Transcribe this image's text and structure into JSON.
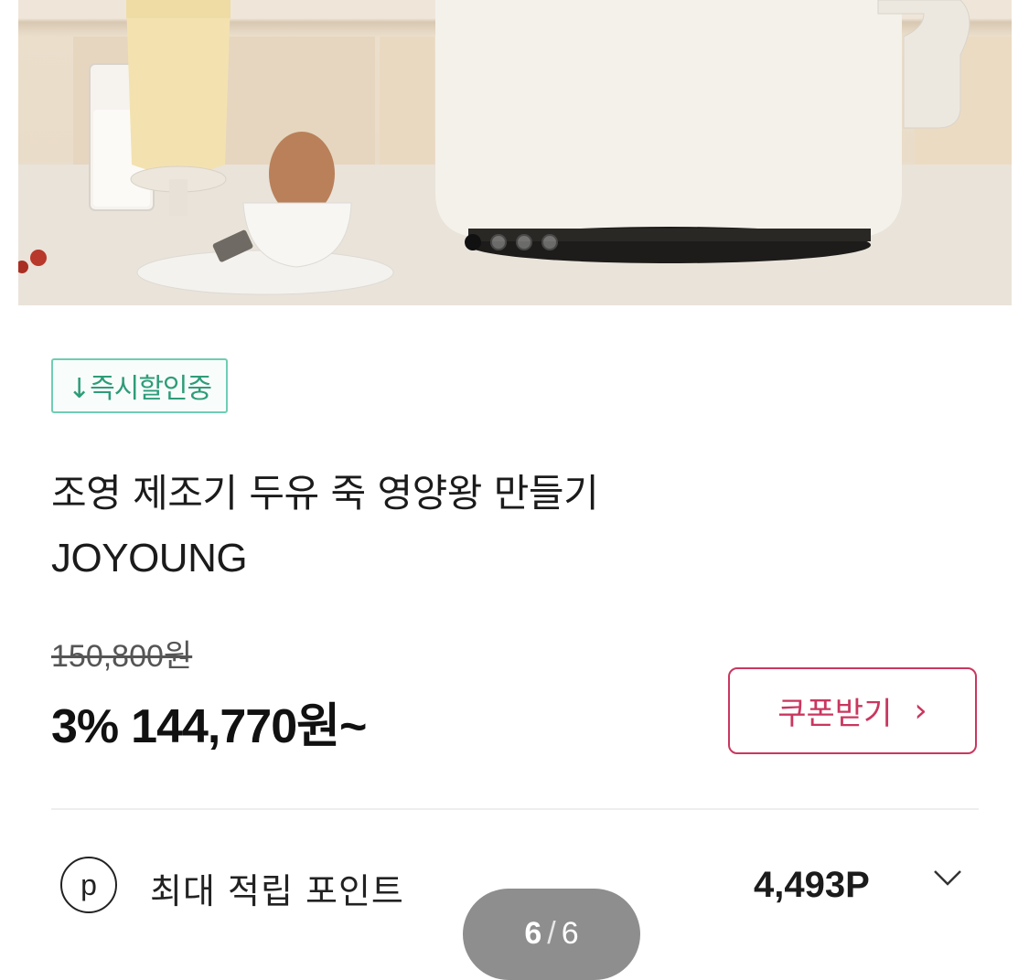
{
  "hero": {
    "carousel_dots": [
      true,
      false,
      false,
      false
    ]
  },
  "badge": {
    "text": "↓즉시할인중"
  },
  "product": {
    "title": "조영 제조기 두유 죽 영양왕 만들기",
    "brand": "JOYOUNG"
  },
  "price": {
    "original": "150,800원",
    "discount": "3%",
    "sale": "144,770원~"
  },
  "coupon": {
    "label": "쿠폰받기",
    "chevron": "›"
  },
  "points": {
    "icon_letter": "p",
    "label": "최대 적립 포인트",
    "value": "4,493P"
  },
  "pager": {
    "current": "6",
    "separator": "/",
    "total": "6"
  },
  "colors": {
    "badge_green": "#2e9c79",
    "coupon_red": "#c9375f",
    "pager_bg": "#8e8e8e"
  }
}
